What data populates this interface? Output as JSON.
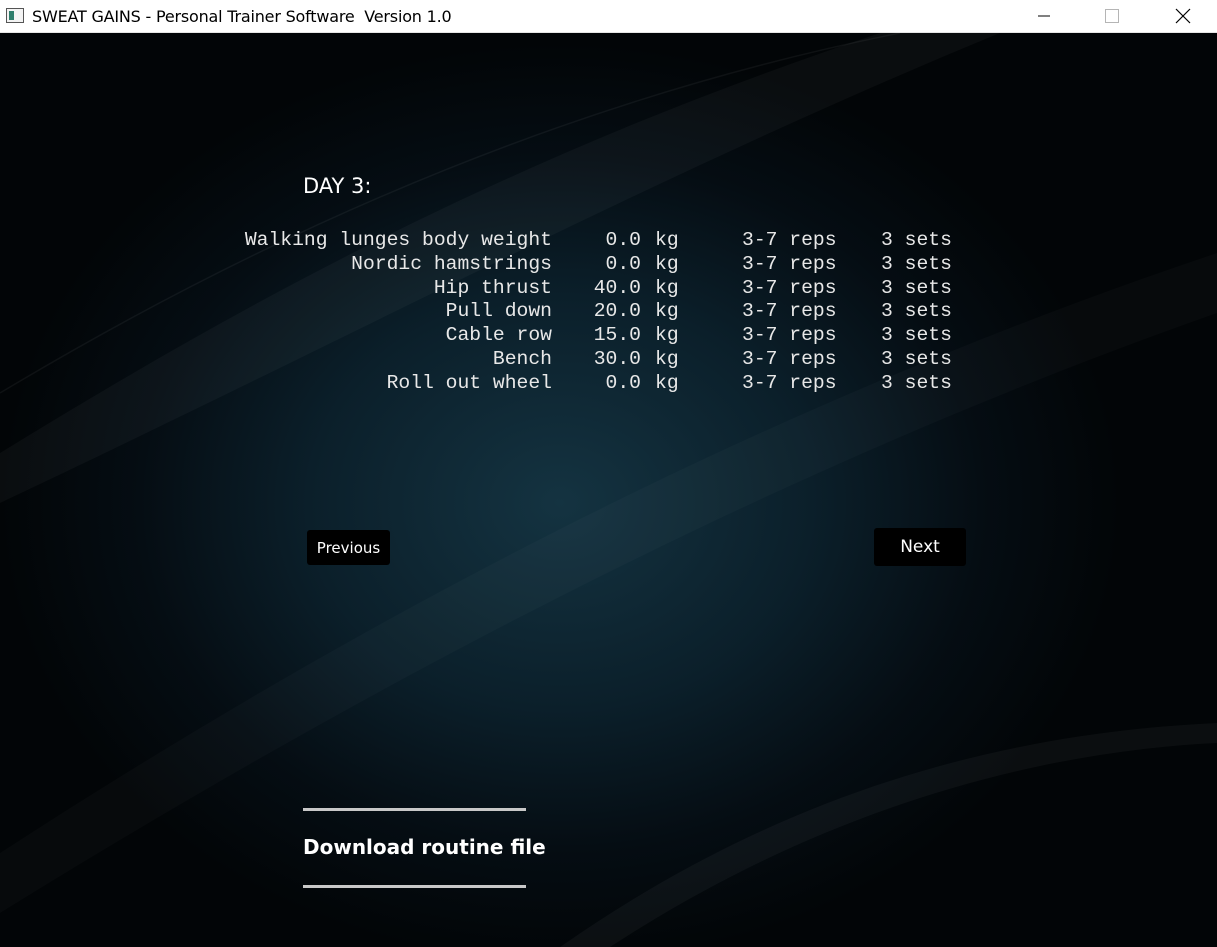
{
  "window": {
    "title": "SWEAT GAINS - Personal Trainer Software  Version 1.0",
    "icon": "app-window-icon"
  },
  "day": {
    "title": "DAY 3:"
  },
  "exercises": [
    {
      "name": "Walking lunges body weight",
      "weight": "0.0",
      "unit": "kg",
      "reps": "3-7 reps",
      "sets": "3 sets"
    },
    {
      "name": "Nordic hamstrings",
      "weight": "0.0",
      "unit": "kg",
      "reps": "3-7 reps",
      "sets": "3 sets"
    },
    {
      "name": "Hip thrust",
      "weight": "40.0",
      "unit": "kg",
      "reps": "3-7 reps",
      "sets": "3 sets"
    },
    {
      "name": "Pull down",
      "weight": "20.0",
      "unit": "kg",
      "reps": "3-7 reps",
      "sets": "3 sets"
    },
    {
      "name": "Cable row",
      "weight": "15.0",
      "unit": "kg",
      "reps": "3-7 reps",
      "sets": "3 sets"
    },
    {
      "name": "Bench",
      "weight": "30.0",
      "unit": "kg",
      "reps": "3-7 reps",
      "sets": "3 sets"
    },
    {
      "name": "Roll out wheel",
      "weight": "0.0",
      "unit": "kg",
      "reps": "3-7 reps",
      "sets": "3 sets"
    }
  ],
  "nav": {
    "previous_label": "Previous",
    "next_label": "Next"
  },
  "download": {
    "label": "Download routine file"
  },
  "colors": {
    "background_center": "#143341",
    "background_edge": "#020507",
    "text": "#ffffff",
    "button_bg": "#000000"
  }
}
